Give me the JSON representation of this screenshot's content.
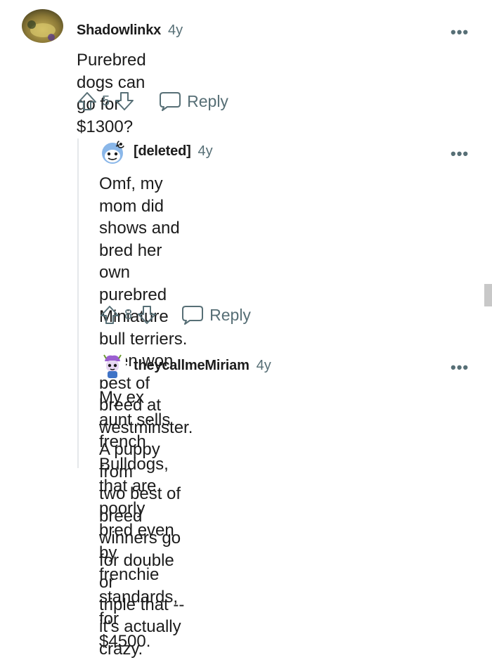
{
  "comments": [
    {
      "username": "Shadowlinkx",
      "age": "4y",
      "text": "Purebred dogs can go for $1300?",
      "score": "5",
      "reply_label": "Reply",
      "menu": "•••"
    },
    {
      "username": "[deleted]",
      "age": "4y",
      "text_lines": [
        "Omf, my mom did shows and bred her own",
        "purebred Miniature bull terriers. Even won",
        "best of breed at westminster. A puppy from",
        "two best of breed winners go for double or",
        "triple that -- it's actually crazy."
      ],
      "score": "8",
      "reply_label": "Reply",
      "menu": "•••"
    },
    {
      "username": "theycallmeMiriam",
      "age": "4y",
      "text_lines": [
        "My ex aunt sells french Bulldogs, that are",
        "poorly bred even by frenchie standards, for",
        "$4500."
      ],
      "menu": "•••"
    }
  ],
  "colors": {
    "text": "#1c1c1c",
    "muted": "#576f76",
    "thread_line": "#e5e8ea",
    "scrollbar": "#c8c8c8"
  },
  "icons": {
    "upvote": "upvote-arrow-icon",
    "downvote": "downvote-arrow-icon",
    "reply": "speech-bubble-icon",
    "menu": "more-options-icon"
  }
}
